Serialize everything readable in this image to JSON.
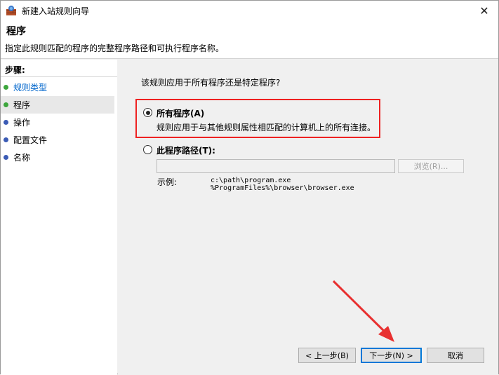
{
  "window": {
    "title": "新建入站规则向导",
    "close_glyph": "✕"
  },
  "header": {
    "title": "程序",
    "description": "指定此规则匹配的程序的完整程序路径和可执行程序名称。"
  },
  "steps": {
    "title": "步骤:",
    "items": [
      {
        "label": "规则类型",
        "dot_color": "#3ca63c",
        "link": true
      },
      {
        "label": "程序",
        "dot_color": "#3ca63c",
        "link": false
      },
      {
        "label": "操作",
        "dot_color": "#3b5bb5",
        "link": false
      },
      {
        "label": "配置文件",
        "dot_color": "#3b5bb5",
        "link": false
      },
      {
        "label": "名称",
        "dot_color": "#3b5bb5",
        "link": false
      }
    ]
  },
  "content": {
    "question": "该规则应用于所有程序还是特定程序?",
    "option_all": {
      "label": "所有程序(A)",
      "description": "规则应用于与其他规则属性相匹配的计算机上的所有连接。",
      "checked": true
    },
    "option_path": {
      "label": "此程序路径(T):",
      "checked": false,
      "value": "",
      "browse_label": "浏览(R)..."
    },
    "example": {
      "label": "示例:",
      "line1": "c:\\path\\program.exe",
      "line2": "%ProgramFiles%\\browser\\browser.exe"
    }
  },
  "buttons": {
    "back": "< 上一步(B)",
    "next": "下一步(N) >",
    "cancel": "取消"
  },
  "colors": {
    "highlight": "#e22222",
    "link": "#0066cc",
    "accent": "#0078d7"
  }
}
